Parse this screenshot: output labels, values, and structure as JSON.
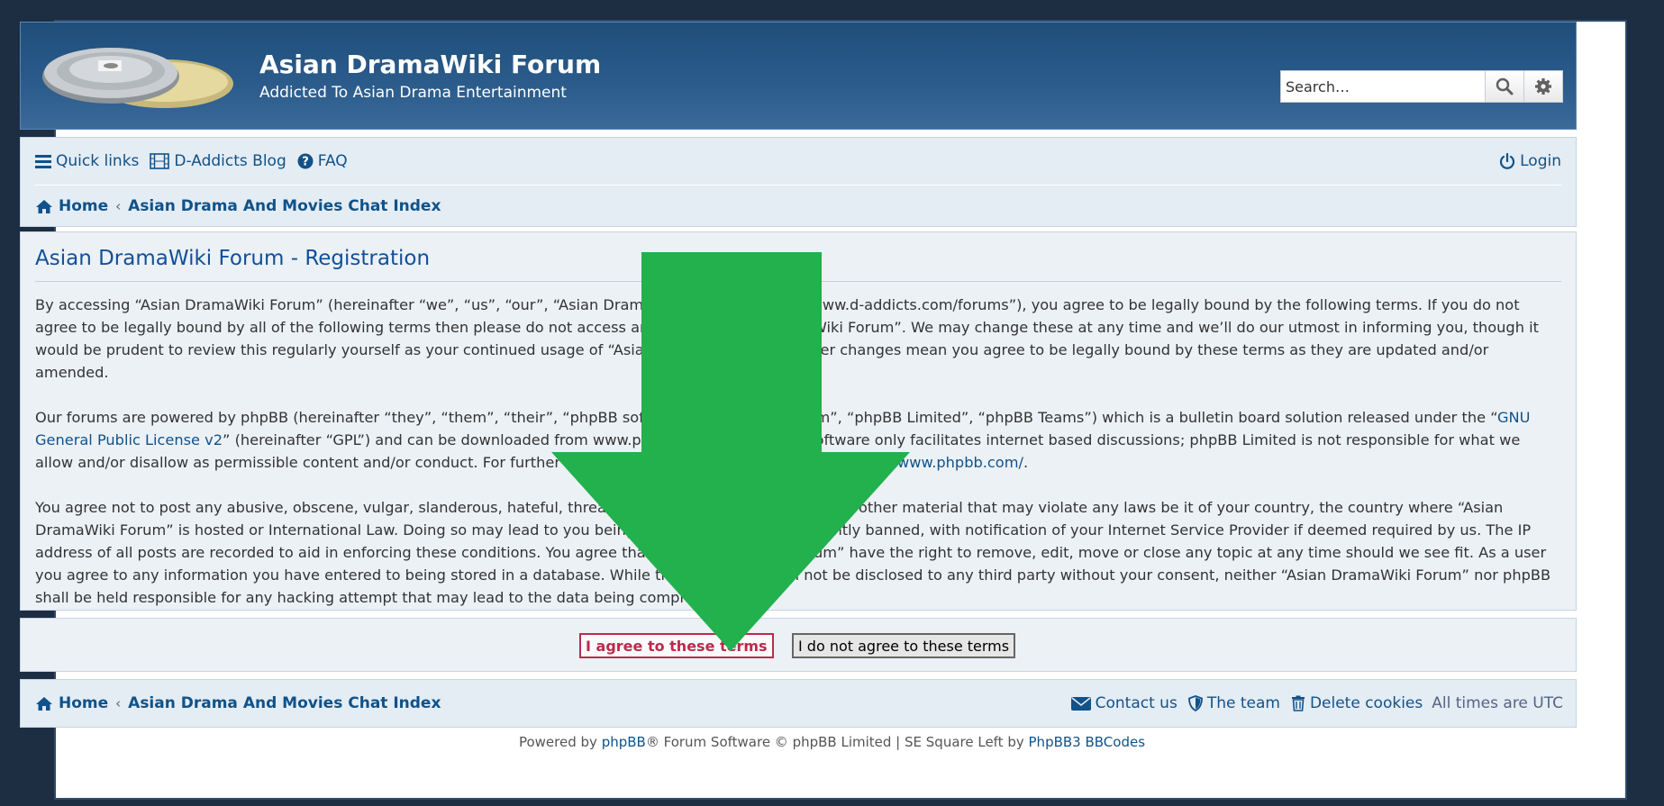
{
  "header": {
    "site_title": "Asian DramaWiki Forum",
    "site_description": "Addicted To Asian Drama Entertainment",
    "search_placeholder": "Search…"
  },
  "nav": {
    "quick_links": "Quick links",
    "blog": "D-Addicts Blog",
    "faq": "FAQ",
    "login": "Login"
  },
  "breadcrumbs": {
    "home": "Home",
    "index": "Asian Drama And Movies Chat Index"
  },
  "registration": {
    "title": "Asian DramaWiki Forum - Registration",
    "para1": "By accessing “Asian DramaWiki Forum” (hereinafter “we”, “us”, “our”, “Asian DramaWiki Forum”, “https://www.d-addicts.com/forums”), you agree to be legally bound by the following terms. If you do not agree to be legally bound by all of the following terms then please do not access and/or use “Asian DramaWiki Forum”. We may change these at any time and we’ll do our utmost in informing you, though it would be prudent to review this regularly yourself as your continued usage of “Asian DramaWiki Forum” after changes mean you agree to be legally bound by these terms as they are updated and/or amended.",
    "para2_a": "Our forums are powered by phpBB (hereinafter “they”, “them”, “their”, “phpBB software”, “www.phpbb.com”, “phpBB Limited”, “phpBB Teams”) which is a bulletin board solution released under the “",
    "para2_link1": "GNU General Public License v2",
    "para2_b": "” (hereinafter “GPL”) and can be downloaded from www.phpbb.com. The phpBB software only facilitates internet based discussions; phpBB Limited is not responsible for what we allow and/or disallow as permissible content and/or conduct. For further information about phpBB, please see: ",
    "para2_link2": "https://www.phpbb.com/",
    "para2_c": ".",
    "para3": "You agree not to post any abusive, obscene, vulgar, slanderous, hateful, threatening, sexually-orientated or any other material that may violate any laws be it of your country, the country where “Asian DramaWiki Forum” is hosted or International Law. Doing so may lead to you being immediately and permanently banned, with notification of your Internet Service Provider if deemed required by us. The IP address of all posts are recorded to aid in enforcing these conditions. You agree that “Asian DramaWiki Forum” have the right to remove, edit, move or close any topic at any time should we see fit. As a user you agree to any information you have entered to being stored in a database. While this information will not be disclosed to any third party without your consent, neither “Asian DramaWiki Forum” nor phpBB shall be held responsible for any hacking attempt that may lead to the data being compromised."
  },
  "actions": {
    "agree": "I agree to these terms",
    "disagree": "I do not agree to these terms"
  },
  "footer": {
    "contact": "Contact us",
    "team": "The team",
    "delete_cookies": "Delete cookies",
    "timezone": "All times are UTC",
    "powered_prefix": "Powered by ",
    "phpbb": "phpBB",
    "powered_middle": "® Forum Software © phpBB Limited | SE Square Left by ",
    "bbcodes": "PhpBB3 BBCodes"
  },
  "colors": {
    "header_bg": "#1f4e79",
    "link": "#105289",
    "agree_red": "#bc2a4d",
    "arrow_green": "#22b14c"
  },
  "icons": [
    "forum-logo-icon",
    "search-icon",
    "gear-icon",
    "hamburger-icon",
    "film-icon",
    "question-icon",
    "power-icon",
    "home-icon",
    "envelope-icon",
    "shield-icon",
    "trash-icon",
    "down-arrow-icon"
  ]
}
